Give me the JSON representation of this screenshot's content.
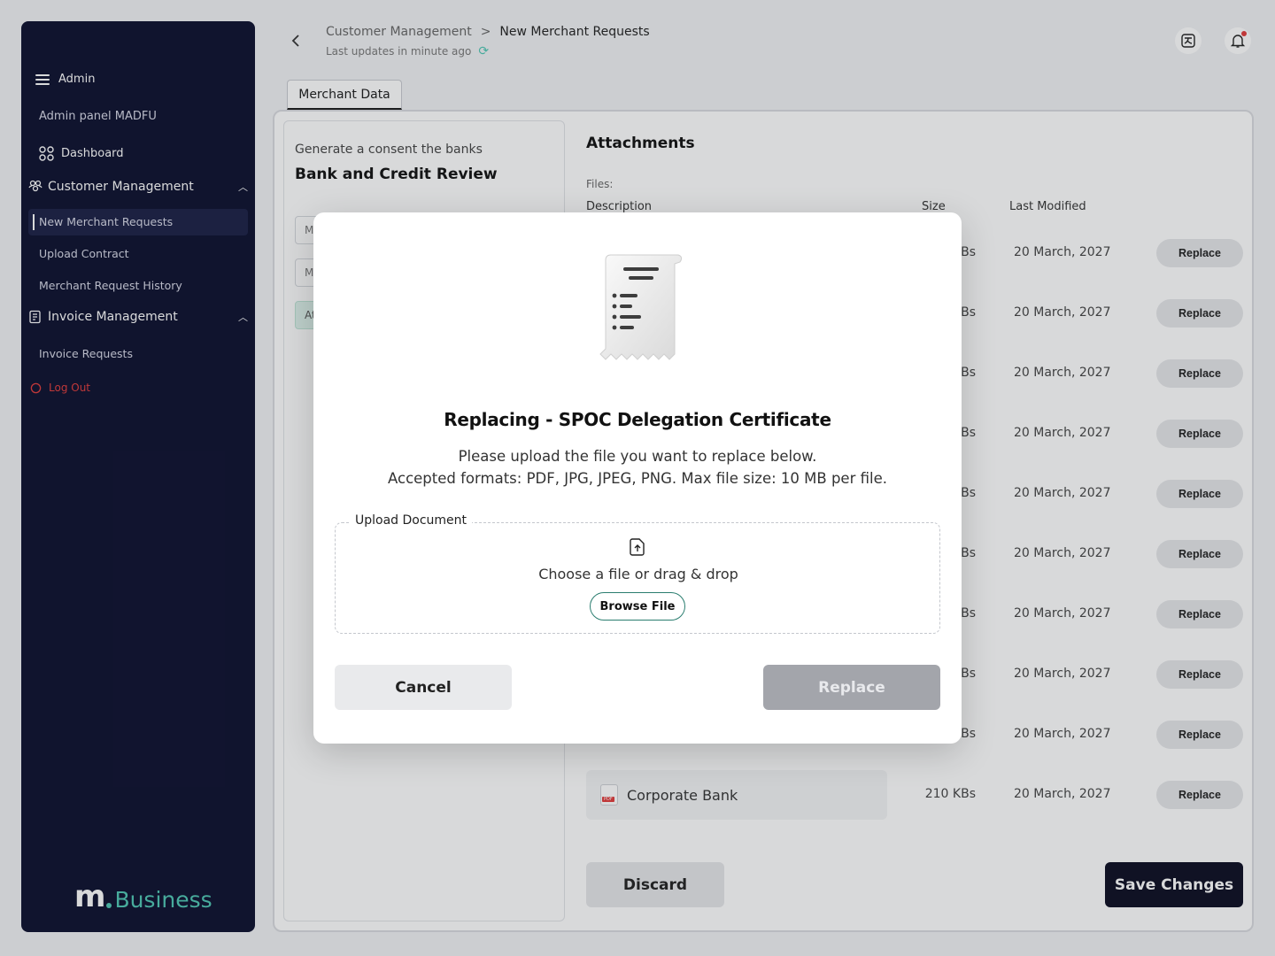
{
  "sidebar": {
    "header_label": "Admin",
    "panel_title": "Admin panel MADFU",
    "dashboard_label": "Dashboard",
    "customer_section": "Customer Management",
    "customer_items": [
      "New Merchant Requests",
      "Upload Contract",
      "Merchant Request History"
    ],
    "invoice_section": "Invoice Management",
    "invoice_items": [
      "Invoice Requests"
    ],
    "logout_label": "Log Out",
    "logo_text": "Business"
  },
  "header": {
    "breadcrumb_root": "Customer Management",
    "breadcrumb_sep": ">",
    "breadcrumb_current": "New Merchant Requests",
    "last_updated": "Last updates in minute ago"
  },
  "tabs": {
    "merchant_data": "Merchant Data"
  },
  "left_card": {
    "subtitle": "Generate a consent the banks",
    "title": "Bank and Credit Review",
    "fields": [
      "M",
      "M",
      "At"
    ]
  },
  "attachments": {
    "title": "Attachments",
    "files_label": "Files:",
    "columns": {
      "description": "Description",
      "size": "Size",
      "last_modified": "Last Modified"
    },
    "replace_label": "Replace",
    "rows": [
      {
        "size": "Bs",
        "date": "20 March, 2027"
      },
      {
        "size": "Bs",
        "date": "20 March, 2027"
      },
      {
        "size": "Bs",
        "date": "20 March, 2027"
      },
      {
        "size": "Bs",
        "date": "20 March, 2027"
      },
      {
        "size": "Bs",
        "date": "20 March, 2027"
      },
      {
        "size": "Bs",
        "date": "20 March, 2027"
      },
      {
        "size": "Bs",
        "date": "20 March, 2027"
      },
      {
        "size": "Bs",
        "date": "20 March, 2027"
      },
      {
        "size": "Bs",
        "date": "20 March, 2027"
      },
      {
        "description": "Corporate Bank",
        "size": "210 KBs",
        "date": "20 March, 2027"
      }
    ]
  },
  "footer": {
    "discard": "Discard",
    "save": "Save Changes"
  },
  "modal": {
    "title": "Replacing - SPOC Delegation Certificate",
    "desc_line1": "Please upload the file you want to replace below.",
    "desc_line2": "Accepted formats: PDF, JPG, JPEG, PNG. Max file size: 10 MB per file.",
    "upload_legend": "Upload Document",
    "upload_text": "Choose a file or drag & drop",
    "browse_label": "Browse File",
    "cancel_label": "Cancel",
    "replace_label": "Replace"
  },
  "colors": {
    "sidebar_bg": "#0c0f2e",
    "accent": "#4fc7b4",
    "danger": "#e23b3b",
    "primary_btn": "#0b0d22"
  }
}
